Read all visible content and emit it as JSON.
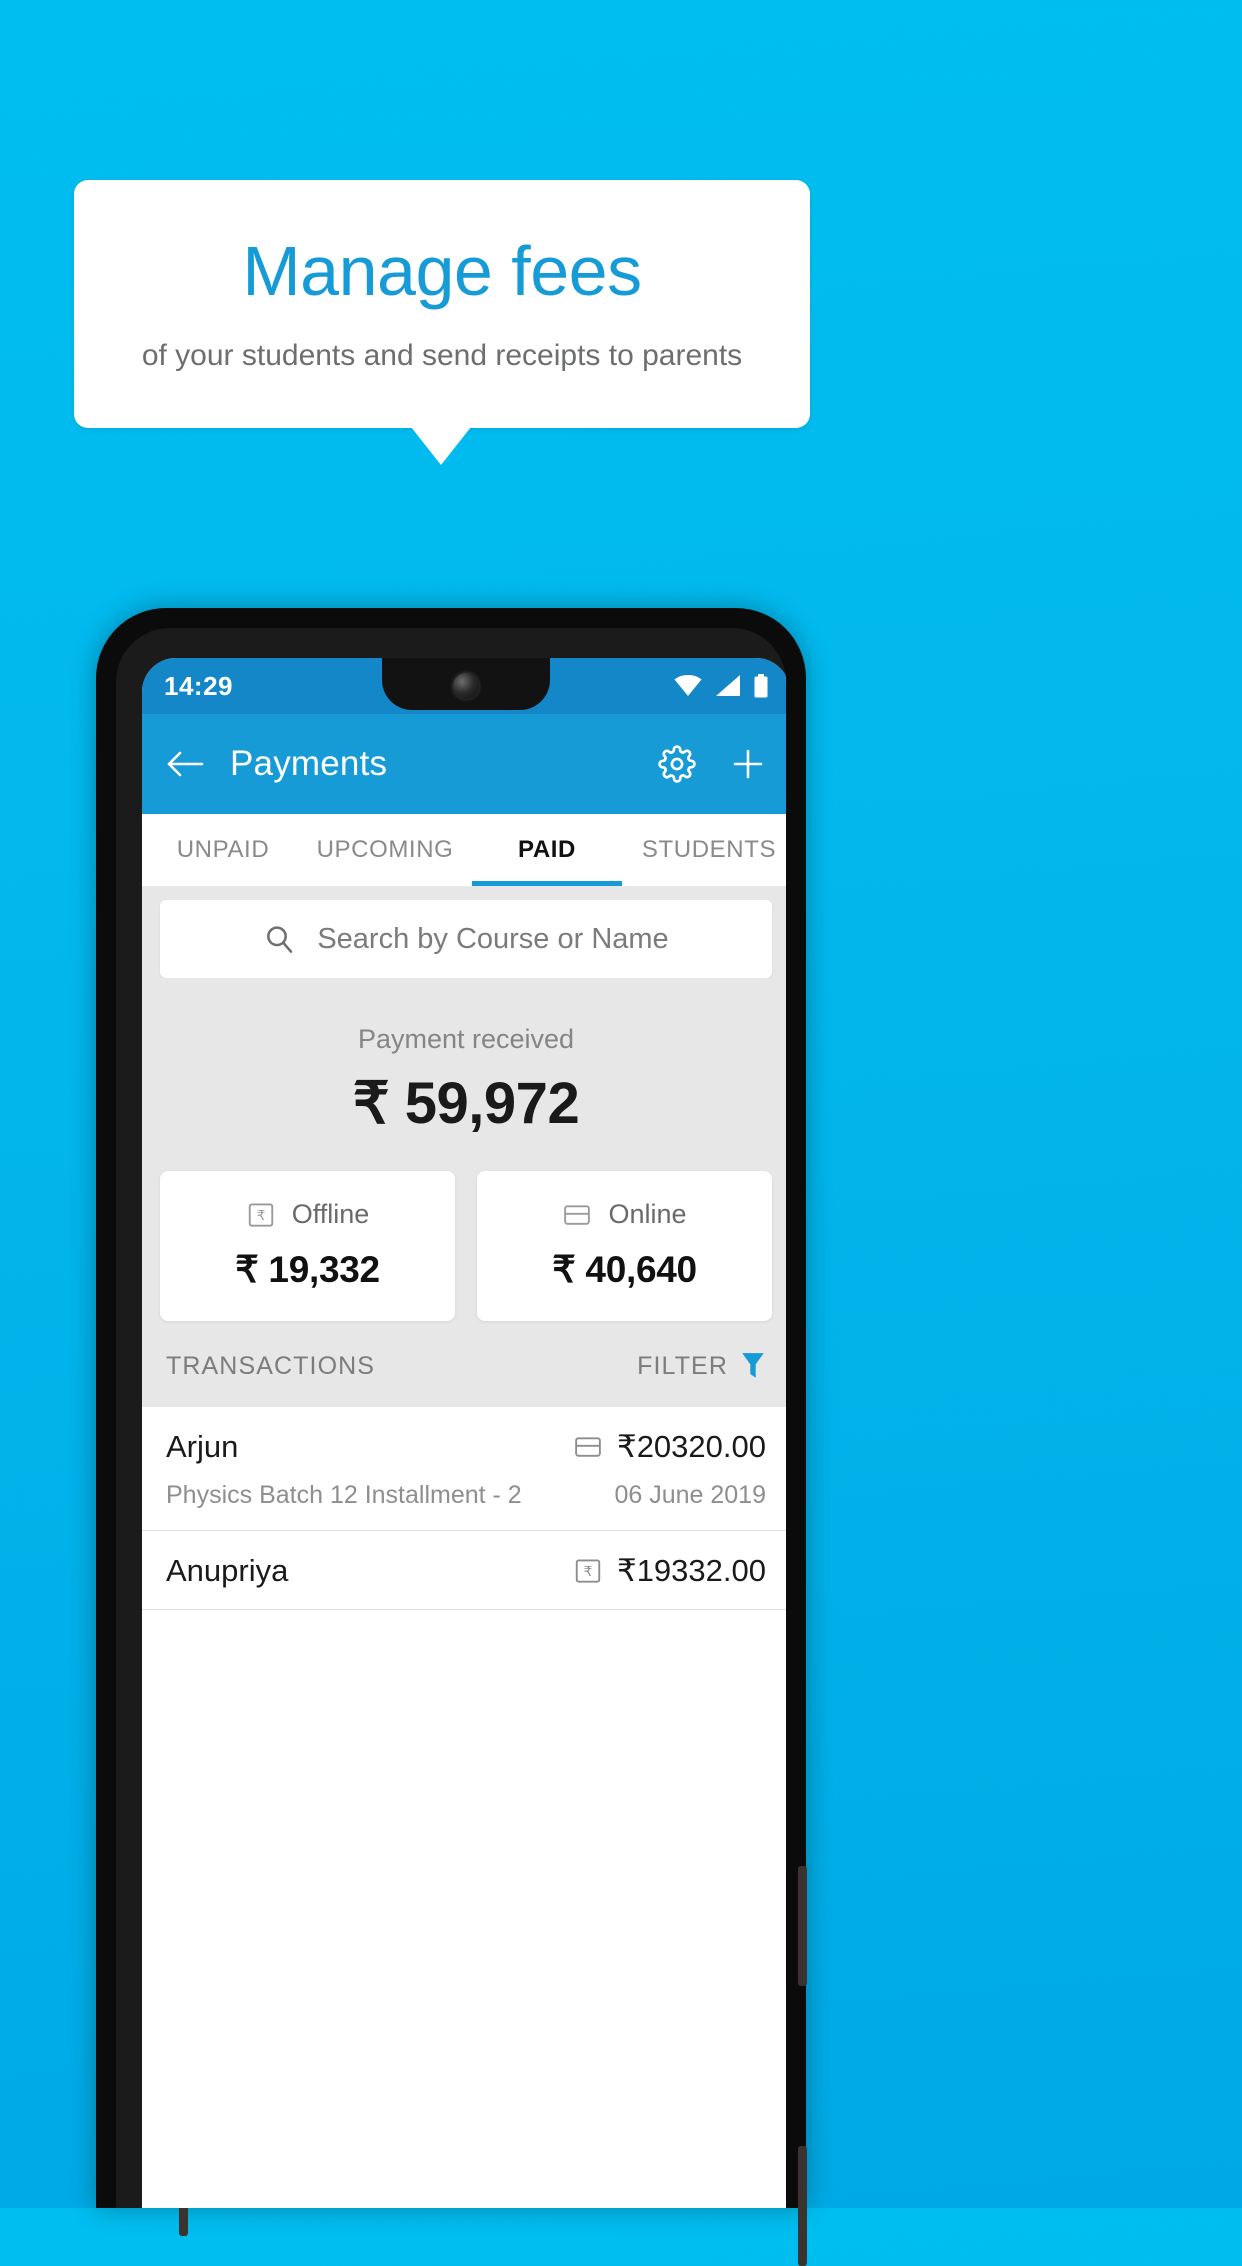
{
  "promo": {
    "title": "Manage fees",
    "subtitle": "of your students and send receipts to parents",
    "title_color": "#169BD7",
    "subtitle_color": "#6D6E70",
    "background_color": "#00B5EC"
  },
  "phone": {
    "status_bar": {
      "time": "14:29",
      "icons": [
        "wifi-icon",
        "signal-icon",
        "battery-icon"
      ],
      "background_color": "#1487C8"
    },
    "app_bar": {
      "back_icon": "back-arrow-icon",
      "title": "Payments",
      "settings_icon": "gear-icon",
      "add_icon": "plus-icon",
      "background_color": "#169BD7"
    },
    "tabs": [
      {
        "label": "UNPAID",
        "active": false
      },
      {
        "label": "UPCOMING",
        "active": false
      },
      {
        "label": "PAID",
        "active": true
      },
      {
        "label": "STUDENTS",
        "active": false
      }
    ],
    "search": {
      "icon": "search-icon",
      "placeholder": "Search by Course or Name"
    },
    "summary": {
      "label": "Payment received",
      "amount": "₹ 59,972"
    },
    "methods": [
      {
        "icon": "cash-receipt-icon",
        "label": "Offline",
        "amount": "₹ 19,332"
      },
      {
        "icon": "credit-card-icon",
        "label": "Online",
        "amount": "₹ 40,640"
      }
    ],
    "transactions_header": {
      "title": "TRANSACTIONS",
      "filter_label": "FILTER",
      "filter_icon": "funnel-icon",
      "filter_icon_color": "#169BD7"
    },
    "transactions": [
      {
        "name": "Arjun",
        "description": "Physics Batch 12 Installment - 2",
        "amount": "₹20320.00",
        "date": "06 June 2019",
        "method_icon": "credit-card-icon"
      },
      {
        "name": "Anupriya",
        "description": "",
        "amount": "₹19332.00",
        "date": "",
        "method_icon": "cash-receipt-icon"
      }
    ]
  }
}
